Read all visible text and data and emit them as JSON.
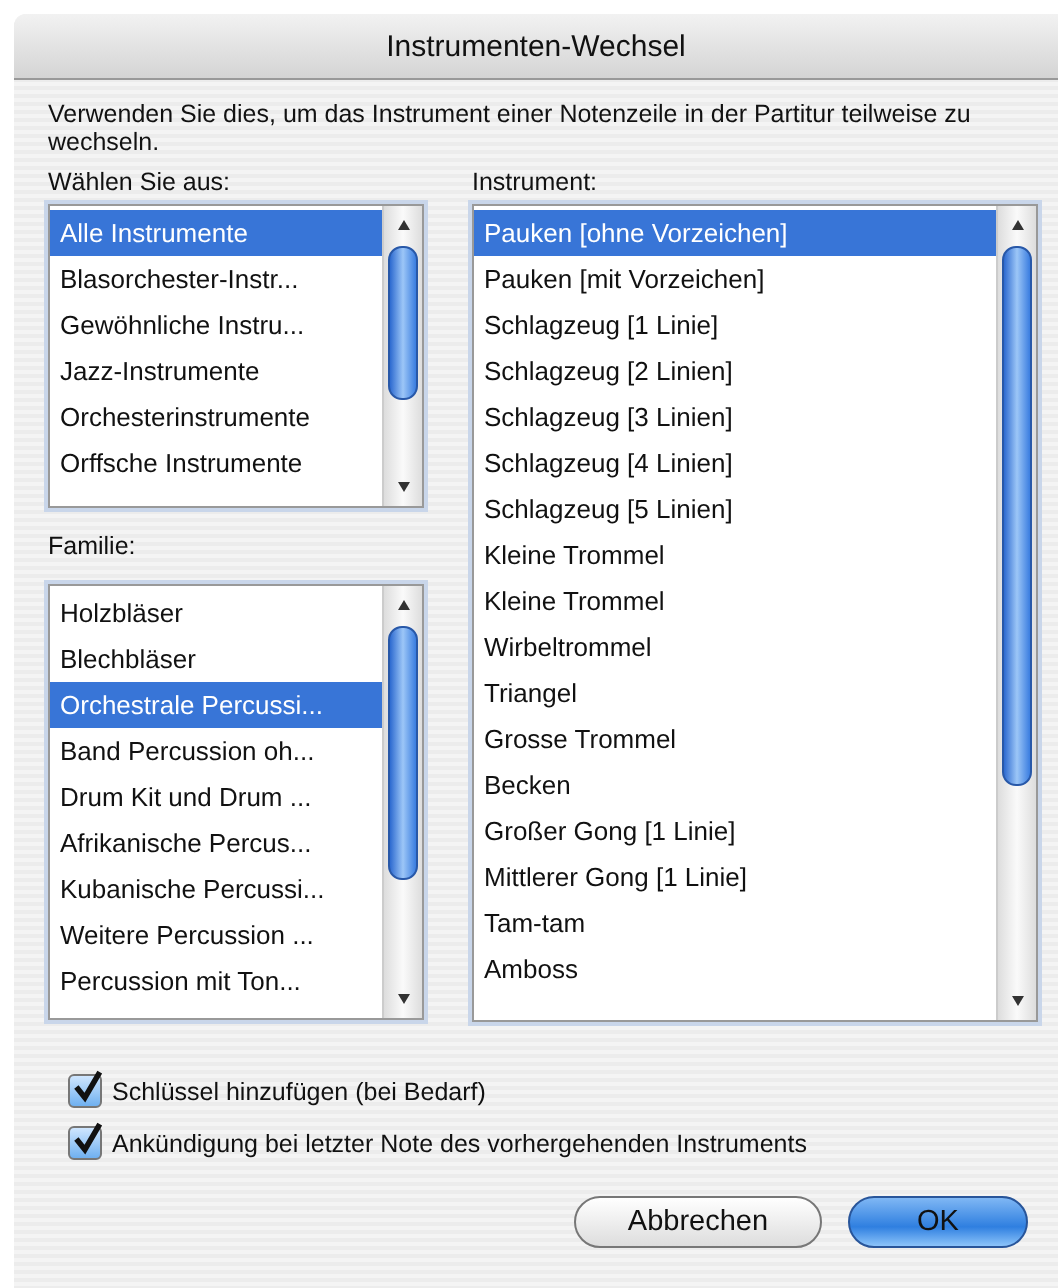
{
  "window": {
    "title": "Instrumenten-Wechsel"
  },
  "description": "Verwenden Sie dies, um das Instrument einer Notenzeile in der Partitur teilweise zu wechseln.",
  "choose": {
    "label": "Wählen Sie aus:",
    "items": [
      {
        "label": "Alle Instrumente",
        "selected": true
      },
      {
        "label": "Blasorchester-Instr...",
        "selected": false
      },
      {
        "label": "Gewöhnliche Instru...",
        "selected": false
      },
      {
        "label": "Jazz-Instrumente",
        "selected": false
      },
      {
        "label": "Orchesterinstrumente",
        "selected": false
      },
      {
        "label": "Orffsche Instrumente",
        "selected": false
      }
    ]
  },
  "family": {
    "label": "Familie:",
    "items": [
      {
        "label": "Holzbläser",
        "selected": false
      },
      {
        "label": "Blechbläser",
        "selected": false
      },
      {
        "label": "Orchestrale Percussi...",
        "selected": true
      },
      {
        "label": "Band Percussion oh...",
        "selected": false
      },
      {
        "label": "Drum Kit und Drum ...",
        "selected": false
      },
      {
        "label": "Afrikanische Percus...",
        "selected": false
      },
      {
        "label": "Kubanische Percussi...",
        "selected": false
      },
      {
        "label": "Weitere Percussion ...",
        "selected": false
      },
      {
        "label": "Percussion mit Ton...",
        "selected": false
      }
    ]
  },
  "instrument": {
    "label": "Instrument:",
    "items": [
      {
        "label": "Pauken [ohne Vorzeichen]",
        "selected": true
      },
      {
        "label": "Pauken [mit Vorzeichen]",
        "selected": false
      },
      {
        "label": "Schlagzeug [1 Linie]",
        "selected": false
      },
      {
        "label": "Schlagzeug [2 Linien]",
        "selected": false
      },
      {
        "label": "Schlagzeug [3 Linien]",
        "selected": false
      },
      {
        "label": "Schlagzeug [4 Linien]",
        "selected": false
      },
      {
        "label": "Schlagzeug [5 Linien]",
        "selected": false
      },
      {
        "label": "Kleine Trommel",
        "selected": false
      },
      {
        "label": "Kleine Trommel",
        "selected": false
      },
      {
        "label": "Wirbeltrommel",
        "selected": false
      },
      {
        "label": "Triangel",
        "selected": false
      },
      {
        "label": "Grosse Trommel",
        "selected": false
      },
      {
        "label": "Becken",
        "selected": false
      },
      {
        "label": "Großer Gong [1 Linie]",
        "selected": false
      },
      {
        "label": "Mittlerer Gong [1 Linie]",
        "selected": false
      },
      {
        "label": "Tam-tam",
        "selected": false
      },
      {
        "label": "Amboss",
        "selected": false
      }
    ]
  },
  "options": [
    {
      "label": "Schlüssel hinzufügen (bei Bedarf)",
      "checked": true
    },
    {
      "label": "Ankündigung bei letzter Note des vorhergehenden Instruments",
      "checked": true
    }
  ],
  "buttons": [
    {
      "label": "Abbrechen",
      "kind": "cancel"
    },
    {
      "label": "OK",
      "kind": "default"
    }
  ]
}
